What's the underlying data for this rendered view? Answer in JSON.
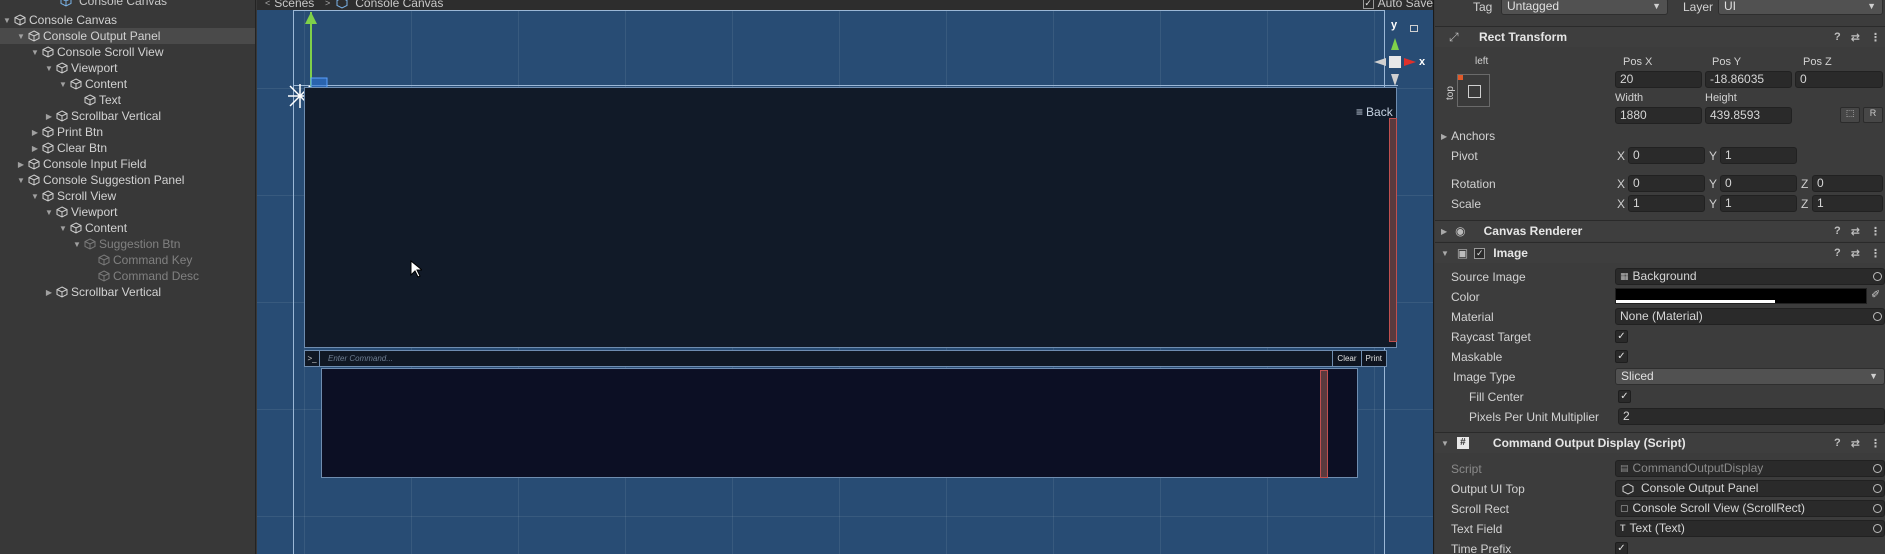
{
  "hierarchy": {
    "top_item": "Console Canvas",
    "items": [
      {
        "label": "Console Canvas",
        "depth": 0,
        "arrow": "down",
        "selected": false,
        "dim": false
      },
      {
        "label": "Console Output Panel",
        "depth": 1,
        "arrow": "down",
        "selected": true,
        "dim": false
      },
      {
        "label": "Console Scroll View",
        "depth": 2,
        "arrow": "down",
        "selected": false,
        "dim": false
      },
      {
        "label": "Viewport",
        "depth": 3,
        "arrow": "down",
        "selected": false,
        "dim": false
      },
      {
        "label": "Content",
        "depth": 4,
        "arrow": "down",
        "selected": false,
        "dim": false
      },
      {
        "label": "Text",
        "depth": 5,
        "arrow": "none",
        "selected": false,
        "dim": false
      },
      {
        "label": "Scrollbar Vertical",
        "depth": 3,
        "arrow": "right",
        "selected": false,
        "dim": false
      },
      {
        "label": "Print Btn",
        "depth": 2,
        "arrow": "right",
        "selected": false,
        "dim": false
      },
      {
        "label": "Clear Btn",
        "depth": 2,
        "arrow": "right",
        "selected": false,
        "dim": false
      },
      {
        "label": "Console Input Field",
        "depth": 1,
        "arrow": "right",
        "selected": false,
        "dim": false
      },
      {
        "label": "Console Suggestion Panel",
        "depth": 1,
        "arrow": "down",
        "selected": false,
        "dim": false
      },
      {
        "label": "Scroll View",
        "depth": 2,
        "arrow": "down",
        "selected": false,
        "dim": false
      },
      {
        "label": "Viewport",
        "depth": 3,
        "arrow": "down",
        "selected": false,
        "dim": false
      },
      {
        "label": "Content",
        "depth": 4,
        "arrow": "down",
        "selected": false,
        "dim": false
      },
      {
        "label": "Suggestion Btn",
        "depth": 5,
        "arrow": "down",
        "selected": false,
        "dim": true
      },
      {
        "label": "Command Key",
        "depth": 6,
        "arrow": "none",
        "selected": false,
        "dim": true
      },
      {
        "label": "Command Desc",
        "depth": 6,
        "arrow": "none",
        "selected": false,
        "dim": true
      },
      {
        "label": "Scrollbar Vertical",
        "depth": 3,
        "arrow": "right",
        "selected": false,
        "dim": false
      }
    ]
  },
  "scene": {
    "breadcrumb_scenes": "Scenes",
    "breadcrumb_canvas": "Console Canvas",
    "auto_save_label": "Auto Save",
    "back_label": "Back",
    "input_placeholder": "Enter Command...",
    "prompt_label": ">_",
    "clear_label": "Clear",
    "print_label": "Print",
    "gizmo_y": "y",
    "gizmo_x": "x"
  },
  "inspector": {
    "tag_label": "Tag",
    "tag_value": "Untagged",
    "layer_label": "Layer",
    "layer_value": "UI",
    "rect_transform": {
      "title": "Rect Transform",
      "anchor_h": "left",
      "anchor_v": "top",
      "pos_x_label": "Pos X",
      "pos_x": "20",
      "pos_y_label": "Pos Y",
      "pos_y": "-18.86035",
      "pos_z_label": "Pos Z",
      "pos_z": "0",
      "width_label": "Width",
      "width": "1880",
      "height_label": "Height",
      "height": "439.8593",
      "anchors_label": "Anchors",
      "pivot_label": "Pivot",
      "pivot_x": "0",
      "pivot_y": "1",
      "rotation_label": "Rotation",
      "rot_x": "0",
      "rot_y": "0",
      "rot_z": "0",
      "scale_label": "Scale",
      "scale_x": "1",
      "scale_y": "1",
      "scale_z": "1",
      "btn_blueprint": "⬚",
      "btn_raw": "R"
    },
    "canvas_renderer": {
      "title": "Canvas Renderer"
    },
    "image": {
      "title": "Image",
      "source_image_label": "Source Image",
      "source_image": "Background",
      "color_label": "Color",
      "material_label": "Material",
      "material": "None (Material)",
      "raycast_label": "Raycast Target",
      "maskable_label": "Maskable",
      "image_type_label": "Image Type",
      "image_type": "Sliced",
      "fill_center_label": "Fill Center",
      "ppu_label": "Pixels Per Unit Multiplier",
      "ppu": "2"
    },
    "command_output": {
      "title": "Command Output Display (Script)",
      "script_label": "Script",
      "script": "CommandOutputDisplay",
      "output_ui_top_label": "Output UI Top",
      "output_ui_top": "Console Output Panel",
      "scroll_rect_label": "Scroll Rect",
      "scroll_rect": "Console Scroll View (ScrollRect)",
      "text_field_label": "Text Field",
      "text_field": "Text (Text)",
      "time_prefix_label": "Time Prefix"
    }
  },
  "colors": {
    "scene_bg": "#284c74",
    "selection": "#4a4a4a",
    "panel_bg": "#111a28",
    "gizmo_red": "#e0302a",
    "gizmo_green": "#7fd04a"
  }
}
